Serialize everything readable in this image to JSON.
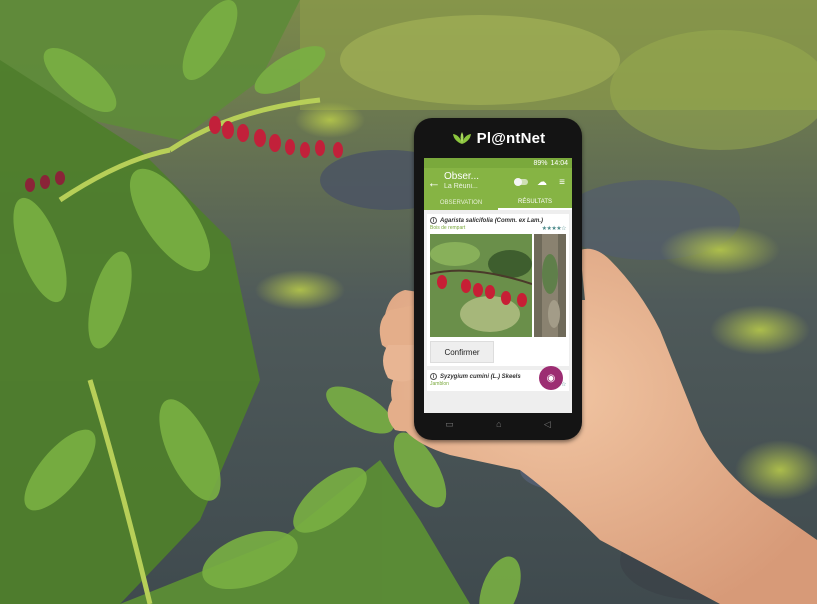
{
  "app": {
    "brand_name": "Pl@ntNet",
    "status": {
      "signal": "89%",
      "time": "14:04"
    },
    "appbar": {
      "title": "Obser...",
      "subtitle": "La Réuni..."
    },
    "tabs": [
      {
        "label": "OBSERVATION"
      },
      {
        "label": "RÉSULTATS"
      }
    ],
    "results": [
      {
        "species": "Agarista salicifolia (Comm. ex Lam.)",
        "common_name": "Bois de rempart",
        "stars": "★★★★☆"
      },
      {
        "species": "Syzygium cumini (L.) Skeels",
        "common_name": "Jamblon",
        "stars": "★★★☆☆"
      }
    ],
    "confirm_label": "Confirmer",
    "icons": {
      "back": "←",
      "upload": "☁",
      "filter": "≡",
      "camera": "◉",
      "nav_back": "◁",
      "nav_home": "⌂",
      "nav_recent": "▭"
    },
    "colors": {
      "brand_green": "#86b444",
      "fab_purple": "#9c2d72"
    }
  }
}
